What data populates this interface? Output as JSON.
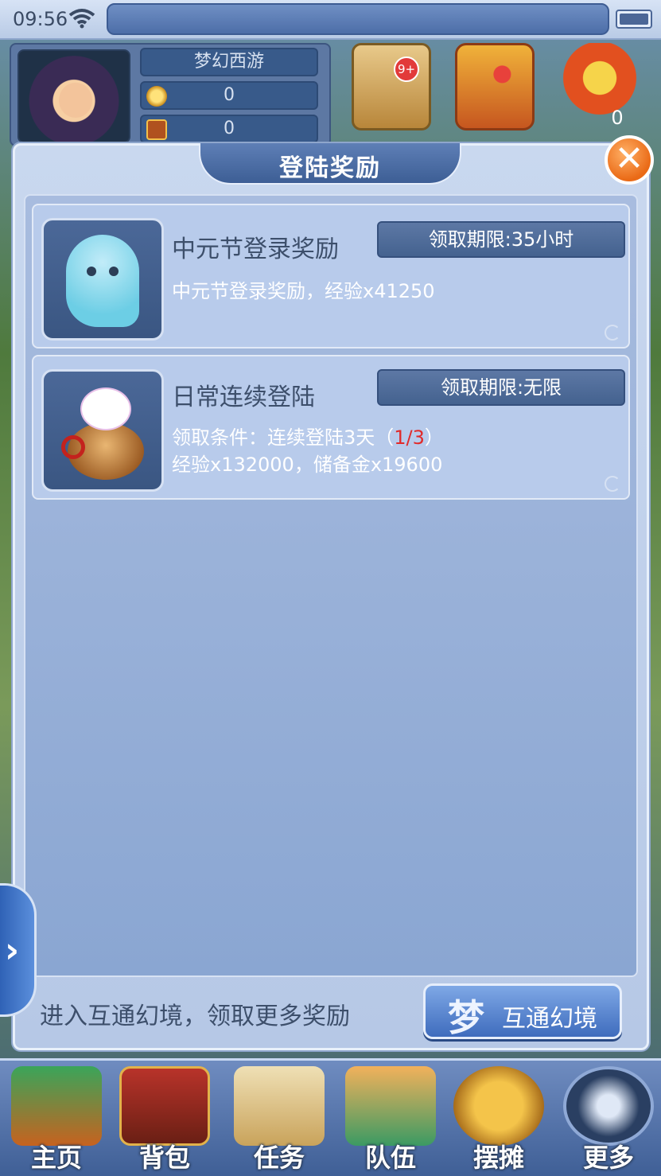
{
  "status_bar": {
    "time": "09:56"
  },
  "player": {
    "server_name": "梦幻西游",
    "coins": "0",
    "chests": "0"
  },
  "top_bar": {
    "badge": "9+",
    "torch_count": "0"
  },
  "dialog": {
    "title": "登陆奖励",
    "close_symbol": "✕",
    "rewards": [
      {
        "name": "中元节登录奖励",
        "limit": "领取期限:35小时",
        "desc": "中元节登录奖励，经验x41250",
        "icon": "ghost-icon"
      },
      {
        "name": "日常连续登陆",
        "limit": "领取期限:无限",
        "condition_prefix": "领取条件：连续登陆3天（",
        "condition_progress": "1/3",
        "condition_suffix": "）",
        "desc": "经验x132000，储备金x19600",
        "icon": "lucky-cat-pot-icon"
      }
    ],
    "footer_text": "进入互通幻境，领取更多奖励",
    "portal_button": {
      "glyph": "梦",
      "label": "互通幻境"
    }
  },
  "side_handle": {
    "arrow": "›"
  },
  "bottom_nav": [
    {
      "label": "主页",
      "icon": "house-icon"
    },
    {
      "label": "背包",
      "icon": "chest-icon"
    },
    {
      "label": "任务",
      "icon": "scroll-icon"
    },
    {
      "label": "队伍",
      "icon": "team-icon"
    },
    {
      "label": "摆摊",
      "icon": "coin-icon"
    },
    {
      "label": "更多",
      "icon": "more-icon"
    }
  ],
  "colors": {
    "accent_blue": "#44628f",
    "close_orange": "#ea6a16",
    "progress_red": "#e12a2a"
  }
}
